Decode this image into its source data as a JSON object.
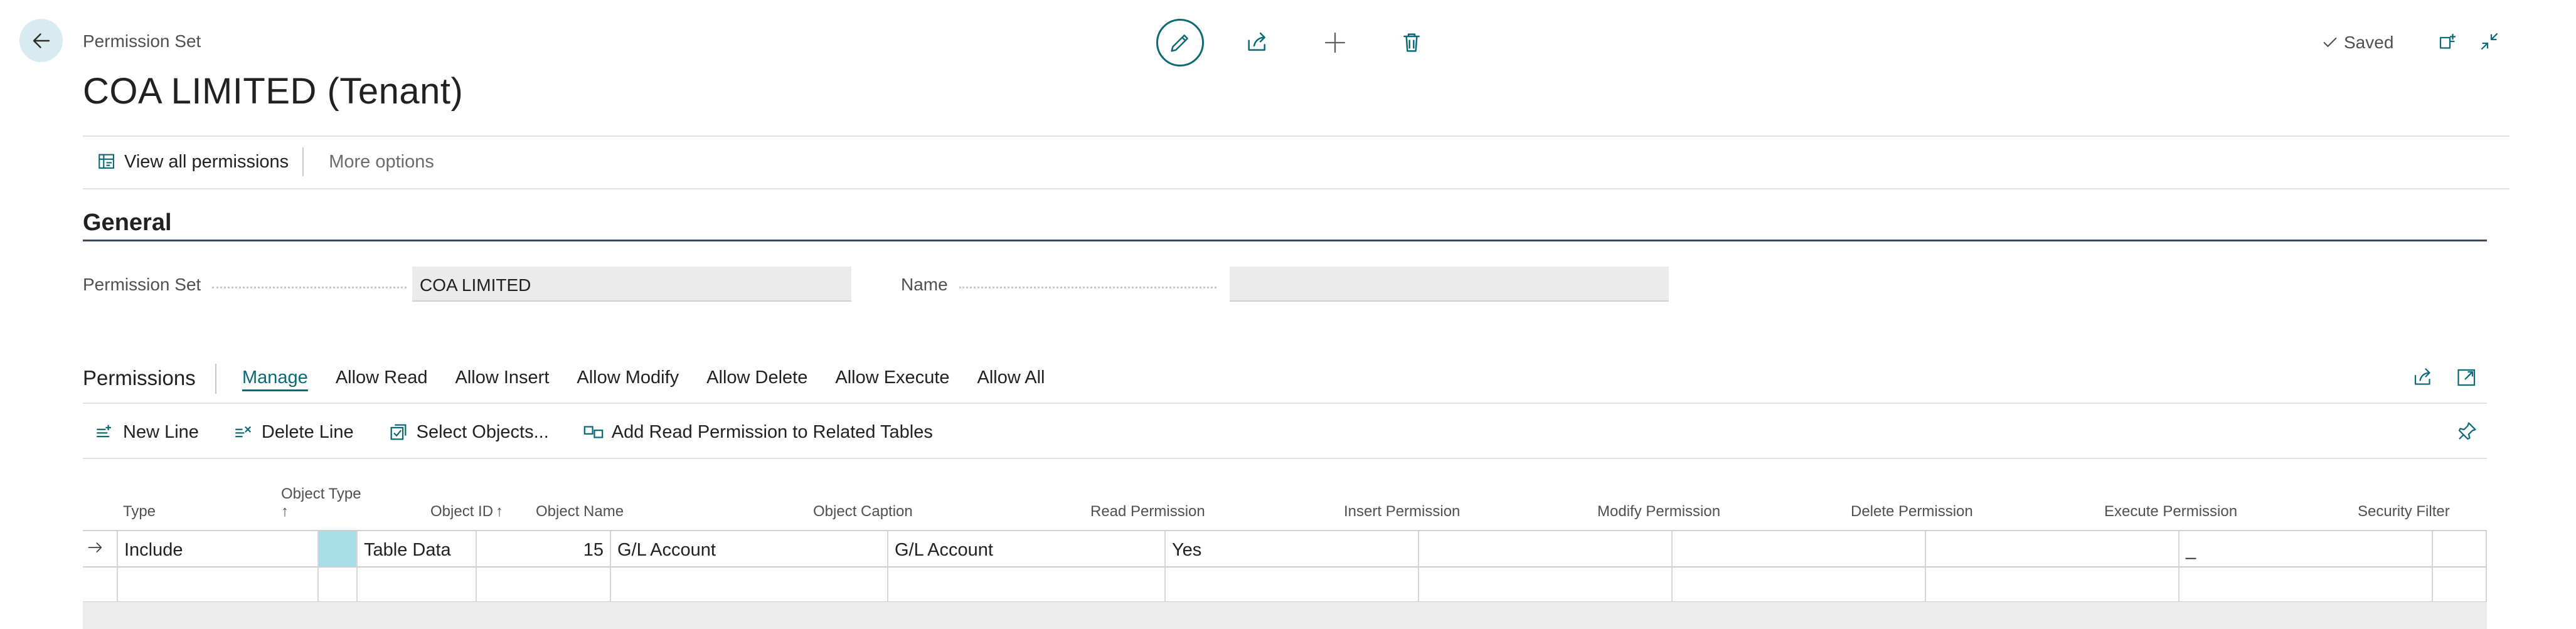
{
  "header": {
    "breadcrumb": "Permission Set",
    "title": "COA LIMITED (Tenant)",
    "saved_label": "Saved"
  },
  "actions": {
    "view_all": "View all permissions",
    "more_options": "More options"
  },
  "general": {
    "section_title": "General",
    "permission_set_label": "Permission Set",
    "permission_set_value": "COA LIMITED",
    "name_label": "Name",
    "name_value": ""
  },
  "permissions": {
    "title": "Permissions",
    "tabs": [
      "Manage",
      "Allow Read",
      "Allow Insert",
      "Allow Modify",
      "Allow Delete",
      "Allow Execute",
      "Allow All"
    ],
    "sub_actions": [
      "New Line",
      "Delete Line",
      "Select Objects...",
      "Add Read Permission to Related Tables"
    ],
    "columns": {
      "type": "Type",
      "object_type": "Object Type",
      "object_type_sort": "↑",
      "object_id": "Object ID",
      "object_id_sort": "↑",
      "object_name": "Object Name",
      "object_caption": "Object Caption",
      "read": "Read Permission",
      "insert": "Insert Permission",
      "modify": "Modify Permission",
      "delete": "Delete Permission",
      "execute": "Execute Permission",
      "security_filter": "Security Filter"
    },
    "rows": [
      {
        "type": "Include",
        "object_type": "Table Data",
        "object_id": "15",
        "object_name": "G/L Account",
        "object_caption": "G/L Account",
        "read": "Yes",
        "insert": "",
        "modify": "",
        "delete": "",
        "execute": "_",
        "security_filter": ""
      }
    ]
  },
  "colors": {
    "accent": "#0b6a76",
    "selection": "#a6dde6"
  }
}
